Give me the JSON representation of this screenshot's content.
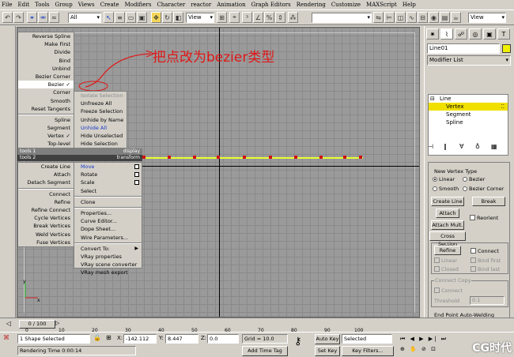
{
  "menubar": [
    "File",
    "Edit",
    "Tools",
    "Group",
    "Views",
    "Create",
    "Modifiers",
    "Character",
    "reactor",
    "Animation",
    "Graph Editors",
    "Rendering",
    "Customize",
    "MAXScript",
    "Help"
  ],
  "toolbar": {
    "selection_filter": "All",
    "refcoord": "View",
    "named_selection": "",
    "refcoord2": "View"
  },
  "annotation": {
    "text": "把点改为bezier类型"
  },
  "quad_menus": {
    "top_left": [
      "Reverse Spline",
      "Make First",
      "Divide",
      "Bind",
      "Unbind",
      "Bezier Corner",
      "Bezier",
      "Corner",
      "Smooth",
      "Reset Tangents",
      "Spline",
      "Segment",
      "Vertex",
      "Top-level"
    ],
    "top_right": [
      "Isolate Selection",
      "Unfreeze All",
      "Freeze Selection",
      "Unhide by Name",
      "Unhide All",
      "Hide Unselected",
      "Hide Selection"
    ],
    "header_tools1": "tools 1",
    "header_display": "display",
    "header_tools2": "tools 2",
    "header_transform": "transform",
    "bottom_left": [
      "Create Line",
      "Attach",
      "Detach Segment",
      "Connect",
      "Refine",
      "Refine Connect",
      "Cycle Vertices",
      "Break Vertices",
      "Weld Vertices",
      "Fuse Vertices"
    ],
    "bottom_right": [
      "Move",
      "Rotate",
      "Scale",
      "Select",
      "Clone",
      "Properties...",
      "Curve Editor...",
      "Dope Sheet...",
      "Wire Parameters...",
      "Convert To:",
      "VRay properties",
      "VRay scene converter",
      "VRay mesh export"
    ]
  },
  "right_panel": {
    "object_name": "Line01",
    "modifier_list": "Modifier List",
    "stack": [
      "Line",
      "Vertex",
      "Segment",
      "Spline"
    ],
    "new_vertex_type": "New Vertex Type",
    "radio_linear": "Linear",
    "radio_bezier": "Bezier",
    "radio_smooth": "Smooth",
    "radio_bezier_corner": "Bezier Corner",
    "create_line": "Create Line",
    "break": "Break",
    "attach": "Attach",
    "reorient": "Reorient",
    "attach_mult": "Attach Mult.",
    "cross_section": "Cross Section",
    "refine": "Refine",
    "connect": "Connect",
    "linear": "Linear",
    "bind_first": "Bind first",
    "closed": "Closed",
    "bind_last": "Bind last",
    "connect_copy": "Connect Copy",
    "connect2": "Connect",
    "threshold": "Threshold",
    "threshold_value": "0.1",
    "end_point": "End Point Auto-Welding"
  },
  "timeline": {
    "slider": "0 / 100",
    "ticks": [
      "0",
      "10",
      "20",
      "30",
      "40",
      "50",
      "60",
      "70",
      "80",
      "90",
      "100"
    ]
  },
  "status": {
    "selection": "1 Shape Selected",
    "render_time": "Rendering Time  0:00:14",
    "x_label": "X:",
    "x_value": "-142.112",
    "y_label": "Y:",
    "y_value": "8.447",
    "z_label": "Z:",
    "z_value": "0.0",
    "grid": "Grid = 10.0",
    "add_time_tag": "Add Time Tag",
    "auto_key": "Auto Key",
    "set_key": "Set Key",
    "selected": "Selected",
    "key_filters": "Key Filters..."
  },
  "watermark": "CG时代"
}
